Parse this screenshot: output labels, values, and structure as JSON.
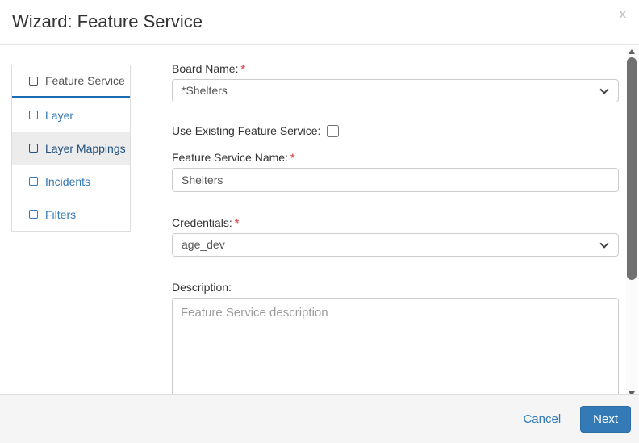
{
  "dialog": {
    "title": "Wizard: Feature Service",
    "close_glyph": "x"
  },
  "sidebar": {
    "items": [
      {
        "label": "Feature Service",
        "state": "active"
      },
      {
        "label": "Layer",
        "state": "normal"
      },
      {
        "label": "Layer Mappings",
        "state": "hover"
      },
      {
        "label": "Incidents",
        "state": "normal"
      },
      {
        "label": "Filters",
        "state": "normal"
      }
    ]
  },
  "form": {
    "board_name": {
      "label": "Board Name:",
      "required_mark": "*",
      "value": "*Shelters"
    },
    "use_existing": {
      "label": "Use Existing Feature Service:",
      "checked": false
    },
    "feature_service_name": {
      "label": "Feature Service Name:",
      "required_mark": "*",
      "value": "Shelters"
    },
    "credentials": {
      "label": "Credentials:",
      "required_mark": "*",
      "value": "age_dev"
    },
    "description": {
      "label": "Description:",
      "placeholder": "Feature Service description",
      "value": ""
    }
  },
  "footer": {
    "cancel_label": "Cancel",
    "next_label": "Next"
  },
  "colors": {
    "accent_blue": "#337ab7",
    "active_tab_underline": "#1a6cb4",
    "required_red": "#e05c5c",
    "sidebar_hover_bg": "#ececec",
    "footer_bg": "#f5f5f5",
    "scrollbar_thumb": "#707070"
  }
}
